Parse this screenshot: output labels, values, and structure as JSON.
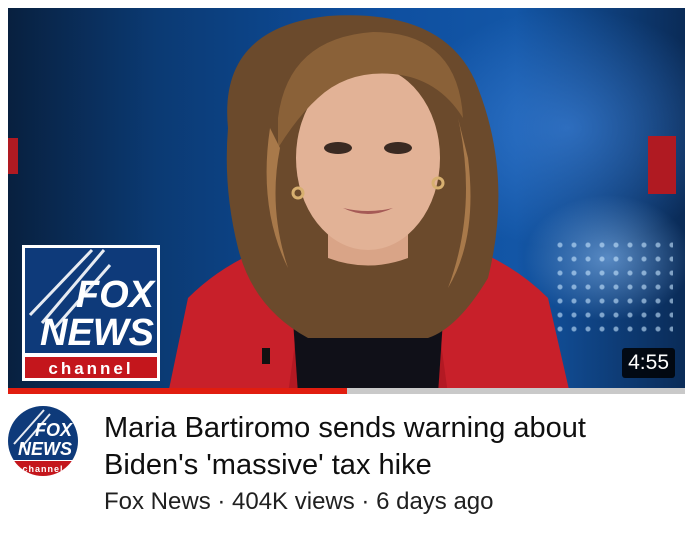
{
  "video": {
    "duration": "4:55",
    "progress": 0.5
  },
  "logo": {
    "fox": "FOX",
    "news": "NEWS",
    "channel": "channel"
  },
  "title": "Maria Bartiromo sends warning about Biden's 'massive' tax hike",
  "meta": {
    "channel": "Fox News",
    "separator": " · ",
    "views": "404K views",
    "age": "6 days ago"
  },
  "colors": {
    "progress": "#e11d0f",
    "logo_blue": "#0e3a7a",
    "logo_red": "#c4161c"
  },
  "icons": {
    "channel_avatar": "fox-news-logo-icon",
    "watermark": "fox-news-logo-icon"
  }
}
